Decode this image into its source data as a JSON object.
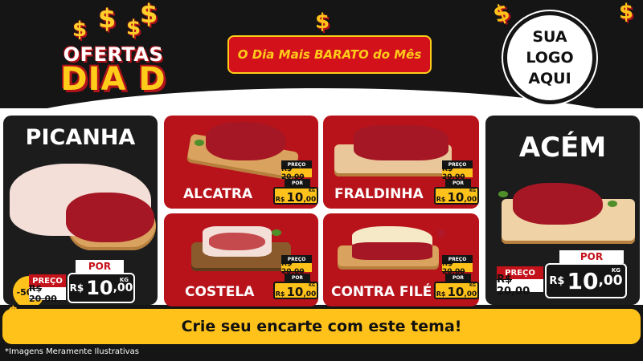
{
  "brand": {
    "line1": "OFERTAS",
    "line2": "DIA D",
    "coin_symbol": "$"
  },
  "headline": "O Dia Mais BARATO do Mês",
  "logo_placeholder": {
    "line1": "SUA",
    "line2": "LOGO",
    "line3": "AQUI"
  },
  "products": {
    "picanha": {
      "name": "PICANHA",
      "discount": "-50%",
      "preco_label": "PREÇO",
      "old_price": "R$ 20,00",
      "por_label": "POR",
      "currency": "R$",
      "price_int": "10",
      "price_dec": ",00",
      "unit": "KG"
    },
    "alcatra": {
      "name": "ALCATRA",
      "preco_label": "PREÇO",
      "old_price": "R$ 20,00",
      "por_label": "POR",
      "currency": "R$",
      "price_int": "10",
      "price_dec": ",00",
      "unit": "KG"
    },
    "fraldinha": {
      "name": "FRALDINHA",
      "preco_label": "PREÇO",
      "old_price": "R$ 20,00",
      "por_label": "POR",
      "currency": "R$",
      "price_int": "10",
      "price_dec": ",00",
      "unit": "KG"
    },
    "costela": {
      "name": "COSTELA",
      "preco_label": "PREÇO",
      "old_price": "R$ 20,00",
      "por_label": "POR",
      "currency": "R$",
      "price_int": "10",
      "price_dec": ",00",
      "unit": "KG"
    },
    "contra_file": {
      "name": "CONTRA FILÉ",
      "preco_label": "PREÇO",
      "old_price": "R$ 20,00",
      "por_label": "POR",
      "currency": "R$",
      "price_int": "10",
      "price_dec": ",00",
      "unit": "KG"
    },
    "acem": {
      "name": "ACÉM",
      "preco_label": "PREÇO",
      "old_price": "R$ 20,00",
      "por_label": "POR",
      "currency": "R$",
      "price_int": "10",
      "price_dec": ",00",
      "unit": "KG"
    }
  },
  "cta": "Crie seu encarte com este tema!",
  "disclaimer": "*Imagens Meramente Ilustrativas",
  "colors": {
    "dark": "#151515",
    "red": "#b8131a",
    "yellow": "#ffc21a",
    "white": "#ffffff"
  }
}
